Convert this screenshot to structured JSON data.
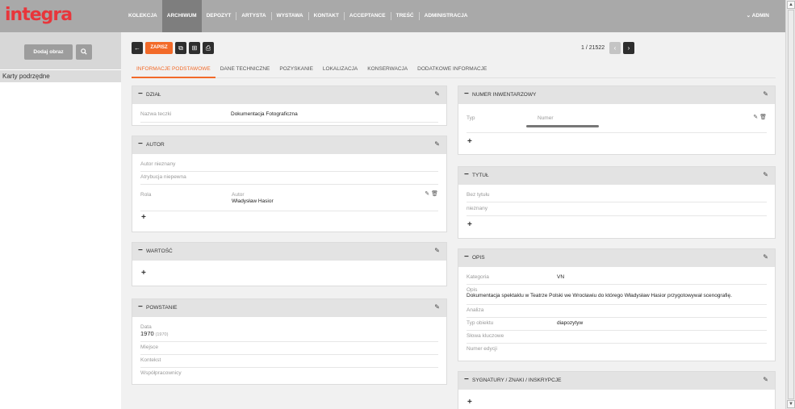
{
  "app": {
    "logo": "integra"
  },
  "nav": {
    "items": [
      "KOLEKCJA",
      "ARCHIWUM",
      "DEPOZYT",
      "ARTYSTA",
      "WYSTAWA",
      "KONTAKT",
      "ACCEPTANCE",
      "TREŚĆ",
      "ADMINISTRACJA"
    ],
    "active": "ARCHIWUM",
    "admin_label": "⌄ ADMIN"
  },
  "sidebar": {
    "add_button": "Dodaj obraz",
    "search_icon": "search-icon",
    "items": [
      "Karty podrzędne"
    ]
  },
  "toolbar": {
    "back_icon": "arrow-left-icon",
    "save_label": "ZAPISZ",
    "copy_icon": "copy-icon",
    "tree_icon": "sitemap-icon",
    "print_icon": "print-icon",
    "pager_text": "1 / 21522",
    "prev_icon": "chevron-left-icon",
    "next_icon": "chevron-right-icon"
  },
  "tabs": [
    "INFORMACJE PODSTAWOWE",
    "DANE TECHNICZNE",
    "POZYSKANIE",
    "LOKALIZACJA",
    "KONSERWACJA",
    "DODATKOWE INFORMACJE"
  ],
  "panels": {
    "dzial": {
      "title": "DZIAŁ",
      "label": "Nazwa teczki",
      "value": "Dokumentacja Fotograficzna"
    },
    "autor": {
      "title": "AUTOR",
      "row1": "Autor nieznany",
      "row2": "Atrybucja niepewna",
      "role_label": "Rola",
      "role_value": "Autor",
      "name": "Władysław Hasior"
    },
    "wartosc": {
      "title": "WARTOŚĆ"
    },
    "powstanie": {
      "title": "POWSTANIE",
      "date_label": "Data",
      "date_value": "1970",
      "date_extra": "(1970)",
      "rows": [
        "Miejsce",
        "Kontekst",
        "Współpracownicy"
      ]
    },
    "numer": {
      "title": "NUMER INWENTARZOWY",
      "typ_label": "Typ",
      "numer_label": "Numer"
    },
    "tytul": {
      "title": "TYTUŁ",
      "rows": [
        "Bez tytułu",
        "nieznany"
      ]
    },
    "opis": {
      "title": "OPIS",
      "kategoria_label": "Kategoria",
      "kategoria_value": "VN",
      "opis_label": "Opis",
      "opis_value": "Dokumentacja spektaklu w Teatrze Polski we Wrocławiu do którego Władysław Hasior przygotowywał scenografię.",
      "analiza_label": "Analiza",
      "typ_label": "Typ obiektu",
      "typ_value": "diapozytyw",
      "slowa_label": "Słowa kluczowe",
      "edycja_label": "Numer edycji"
    },
    "sygnatury": {
      "title": "SYGNATURY / ZNAKI / INSKRYPCJE"
    }
  },
  "colors": {
    "accent": "#f26a29",
    "brand": "#e8363b",
    "topbar": "#a9a9a9",
    "active_nav": "#7e7e7e"
  }
}
